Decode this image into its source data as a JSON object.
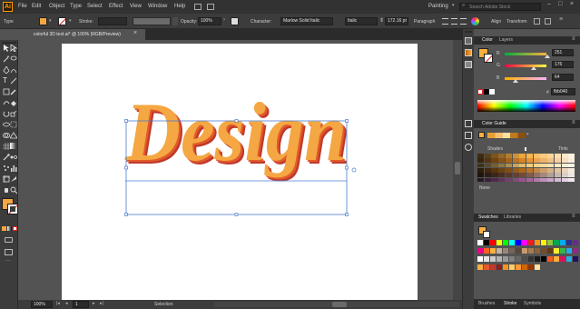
{
  "app": {
    "logo": "Ai",
    "workspace": "Painting",
    "search_placeholder": "Search Adobe Stock"
  },
  "menu": [
    "File",
    "Edit",
    "Object",
    "Type",
    "Select",
    "Effect",
    "View",
    "Window",
    "Help"
  ],
  "control": {
    "type_label": "Type",
    "stroke_label": "Stroke:",
    "opacity_label": "Opacity:",
    "opacity_value": "100%",
    "character_label": "Character:",
    "font_value": "Marlow Solid Italic",
    "style_value": "Italic",
    "size_value": "172.16 pt",
    "paragraph_label": "Paragraph",
    "align_label": "Align",
    "transform_label": "Transform",
    "fill_color": "#f4a742"
  },
  "document": {
    "tab_title": "colorful 3D text.ai* @ 100% (RGB/Preview)",
    "artwork_text": "Design"
  },
  "status": {
    "zoom": "100%",
    "artboard": "1",
    "tool": "Selection"
  },
  "color_panel": {
    "tabs": [
      "Color",
      "Layers"
    ],
    "r_label": "R",
    "g_label": "G",
    "b_label": "B",
    "r_value": "251",
    "g_value": "176",
    "b_value": "64",
    "r_fraction": 0.984,
    "g_fraction": 0.69,
    "b_fraction": 0.251,
    "hex_prefix": "#",
    "hex_value": "fbb040"
  },
  "guide_panel": {
    "title": "Color Guide",
    "shades_label": "Shades",
    "tints_label": "Tints",
    "footer_label": "None"
  },
  "swatches_panel": {
    "tabs": [
      "Swatches",
      "Libraries"
    ]
  },
  "bottom_tabs": [
    "Brushes",
    "Stroke",
    "Symbols"
  ],
  "colors": {
    "orange": "#f4a742",
    "shadow": "#c0392b",
    "selection": "#4a7bd0"
  }
}
